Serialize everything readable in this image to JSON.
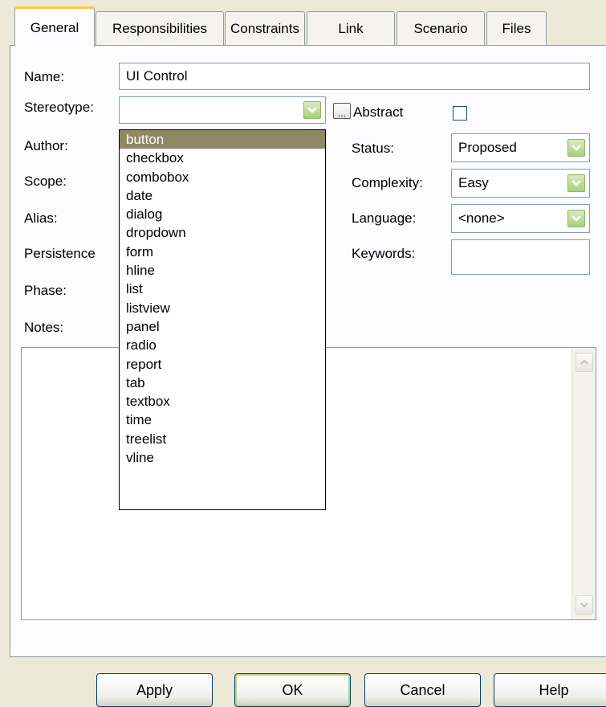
{
  "tabs": [
    {
      "label": "General"
    },
    {
      "label": "Responsibilities"
    },
    {
      "label": "Constraints"
    },
    {
      "label": "Link"
    },
    {
      "label": "Scenario"
    },
    {
      "label": "Files"
    }
  ],
  "fields": {
    "name_label": "Name:",
    "name_value": "UI Control",
    "stereotype_label": "Stereotype:",
    "stereotype_value": "",
    "ellipsis_label": "...",
    "abstract_label": "Abstract",
    "author_label": "Author:",
    "scope_label": "Scope:",
    "alias_label": "Alias:",
    "persistence_label": "Persistence",
    "phase_label": "Phase:",
    "notes_label": "Notes:",
    "status_label": "Status:",
    "status_value": "Proposed",
    "complexity_label": "Complexity:",
    "complexity_value": "Easy",
    "language_label": "Language:",
    "language_value": "<none>",
    "keywords_label": "Keywords:",
    "keywords_value": ""
  },
  "stereotype_options": [
    "button",
    "checkbox",
    "combobox",
    "date",
    "dialog",
    "dropdown",
    "form",
    "hline",
    "list",
    "listview",
    "panel",
    "radio",
    "report",
    "tab",
    "textbox",
    "time",
    "treelist",
    "vline"
  ],
  "stereotype_highlighted": "button",
  "buttons": {
    "apply": "Apply",
    "ok": "OK",
    "cancel": "Cancel",
    "help": "Help"
  },
  "icons": {
    "dropdown_arrow": "chevron-down-icon",
    "scroll_up": "arrow-up-icon",
    "scroll_down": "arrow-down-icon"
  },
  "colors": {
    "window_bg": "#ECE9D8",
    "panel_bg": "#FCFCFE",
    "active_tab_accent": "#FFC83C",
    "highlight_bg": "#8E8864",
    "input_border": "#7F9DB9"
  }
}
